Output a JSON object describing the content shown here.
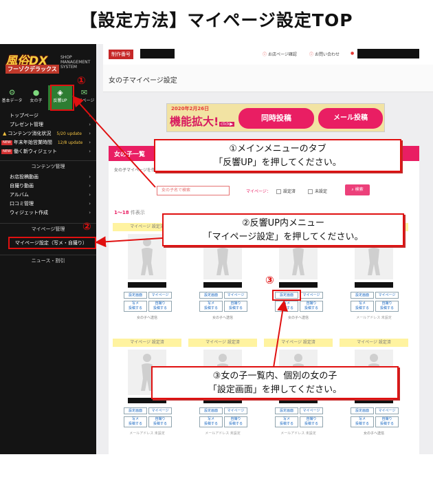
{
  "title": "【設定方法】マイページ設定TOP",
  "sidebar": {
    "logo_main": "風俗DX",
    "logo_sub": "フーゾクデラックス",
    "logo_system": [
      "SHOP",
      "MANAGEMENT",
      "SYSTEM"
    ],
    "tabs": [
      {
        "label": "基本データ",
        "icon": "gear-icon"
      },
      {
        "label": "女の子",
        "icon": "person-icon"
      },
      {
        "label": "反響UP",
        "icon": "megaphone-icon"
      },
      {
        "label": "マイページ",
        "icon": "chat-icon"
      }
    ],
    "menu": [
      {
        "label": "トップページ"
      },
      {
        "label": "プレゼント管理"
      },
      {
        "label": "コンテンツ消化状況",
        "update": "5/20 update"
      },
      {
        "label": "年末年始営業時間",
        "update": "12/8 update"
      },
      {
        "label": "働く新ウィジェット"
      }
    ],
    "section_content": "コンテンツ管理",
    "content_menu": [
      {
        "label": "お店投稿動画"
      },
      {
        "label": "自撮り動画"
      },
      {
        "label": "アルバム"
      },
      {
        "label": "口コミ管理"
      },
      {
        "label": "ウィジェット作成"
      }
    ],
    "section_mypage": "マイページ管理",
    "mypage_item": "マイページ設定（写メ・自撮り）",
    "section_news": "ニュース・割引",
    "new_badge": "NEW"
  },
  "topbar": {
    "biz_label": "制作番号",
    "link1": "お店ページ確認",
    "link2": "お問い合わせ"
  },
  "page_heading": "女の子マイページ設定",
  "banner": {
    "date": "2020年2月26日",
    "main": "機能拡大!",
    "click": "click▶",
    "feature1": "同時投稿",
    "feature2": "メール投稿"
  },
  "panel": {
    "header": "女の子一覧",
    "desc": "女の子マイページを作",
    "search_placeholder": "女の子名で検索",
    "filter_label": "マイページ：",
    "filter1": "設定済",
    "filter2": "未設定",
    "search_button": "検索",
    "count": "1〜18",
    "count_suffix": "件表示"
  },
  "card": {
    "caption": "マイページ 設定済",
    "btn_settings": "設定画面",
    "btn_mypage": "マイページ",
    "btn_photo": "写メ\n投稿する",
    "btn_selfie": "自撮り\n投稿する",
    "mail_send": "女の子へ送信",
    "mail_unset": "メールアドレス 未設定"
  },
  "markers": {
    "m1": "①",
    "m2": "②",
    "m3": "③"
  },
  "callouts": {
    "c1_line1": "①メインメニューのタブ",
    "c1_line2": "「反響UP」を押してください。",
    "c2_line1": "②反響UP内メニュー",
    "c2_line2": "「マイページ設定」を押してください。",
    "c3_line1": "③女の子一覧内、個別の女の子",
    "c3_line2": "「設定画面」を押してください。"
  },
  "colors": {
    "highlight": "#e01010",
    "accent": "#e91e63",
    "sidebar_bg": "#141414"
  }
}
